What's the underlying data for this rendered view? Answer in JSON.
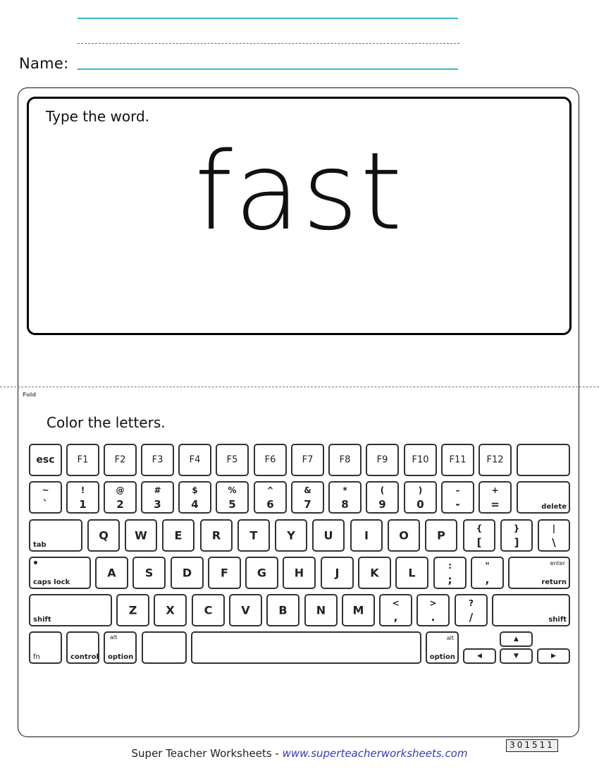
{
  "header": {
    "name_label": "Name:"
  },
  "word_section": {
    "prompt": "Type the word.",
    "word": "fast"
  },
  "fold_label": "Fold",
  "keyboard_section": {
    "prompt": "Color the letters."
  },
  "keyboard": {
    "function_row": [
      "esc",
      "F1",
      "F2",
      "F3",
      "F4",
      "F5",
      "F6",
      "F7",
      "F8",
      "F9",
      "F10",
      "F11",
      "F12"
    ],
    "number_row": [
      {
        "top": "~",
        "bottom": "`"
      },
      {
        "top": "!",
        "bottom": "1"
      },
      {
        "top": "@",
        "bottom": "2"
      },
      {
        "top": "#",
        "bottom": "3"
      },
      {
        "top": "$",
        "bottom": "4"
      },
      {
        "top": "%",
        "bottom": "5"
      },
      {
        "top": "^",
        "bottom": "6"
      },
      {
        "top": "&",
        "bottom": "7"
      },
      {
        "top": "*",
        "bottom": "8"
      },
      {
        "top": "(",
        "bottom": "9"
      },
      {
        "top": ")",
        "bottom": "0"
      },
      {
        "top": "–",
        "bottom": "-"
      },
      {
        "top": "+",
        "bottom": "="
      }
    ],
    "delete_label": "delete",
    "tab_label": "tab",
    "qwerty_row": [
      "Q",
      "W",
      "E",
      "R",
      "T",
      "Y",
      "U",
      "I",
      "O",
      "P"
    ],
    "bracket_keys": [
      {
        "top": "{",
        "bottom": "["
      },
      {
        "top": "}",
        "bottom": "]"
      },
      {
        "top": "|",
        "bottom": "\\"
      }
    ],
    "caps_label": "caps lock",
    "home_row": [
      "A",
      "S",
      "D",
      "F",
      "G",
      "H",
      "J",
      "K",
      "L"
    ],
    "home_punct": [
      {
        "top": ":",
        "bottom": ";"
      },
      {
        "top": "\"",
        "bottom": ","
      }
    ],
    "enter_label": "enter",
    "return_label": "return",
    "shift_label": "shift",
    "bottom_letters": [
      "Z",
      "X",
      "C",
      "V",
      "B",
      "N",
      "M"
    ],
    "bottom_punct": [
      {
        "top": "<",
        "bottom": ","
      },
      {
        "top": ">",
        "bottom": "."
      },
      {
        "top": "?",
        "bottom": "/"
      }
    ],
    "fn_label": "fn",
    "control_label": "control",
    "alt_label": "alt",
    "option_label": "option",
    "arrows": {
      "up": "▲",
      "left": "◀",
      "down": "▼",
      "right": "▶"
    }
  },
  "footer": {
    "brand": "Super Teacher Worksheets - ",
    "url": "www.superteacherworksheets.com",
    "code": "301511"
  }
}
